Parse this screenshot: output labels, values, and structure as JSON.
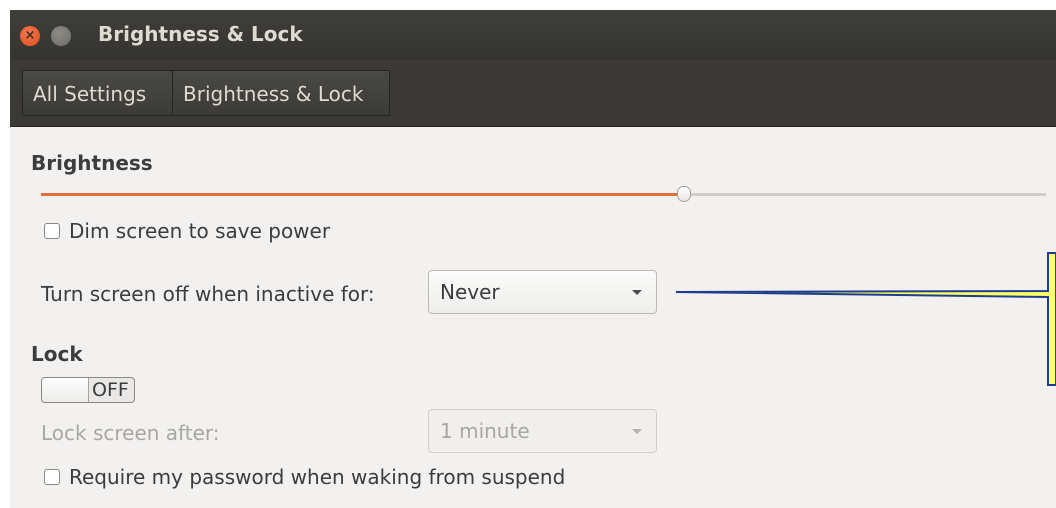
{
  "window": {
    "title": "Brightness & Lock",
    "close_glyph": "×"
  },
  "breadcrumb": {
    "items": [
      {
        "label": "All Settings"
      },
      {
        "label": "Brightness & Lock"
      }
    ]
  },
  "brightness": {
    "heading": "Brightness",
    "level_fraction": 0.64,
    "dim_checkbox": {
      "label": "Dim screen to save power",
      "checked": false
    },
    "screen_off": {
      "label": "Turn screen off when inactive for:",
      "value": "Never"
    }
  },
  "lock": {
    "heading": "Lock",
    "toggle": {
      "state_label": "OFF",
      "on": false
    },
    "lock_after": {
      "label": "Lock screen after:",
      "value": "1 minute",
      "enabled": false
    },
    "password_checkbox": {
      "label": "Require my password when waking from suspend",
      "checked": false
    }
  },
  "colors": {
    "accent": "#e0703a",
    "callout_fill": "#ffff66",
    "callout_stroke": "#1f3d8a"
  },
  "icons": {
    "close": "close-icon",
    "minimize": "minimize-icon",
    "dropdown": "chevron-down-icon"
  }
}
